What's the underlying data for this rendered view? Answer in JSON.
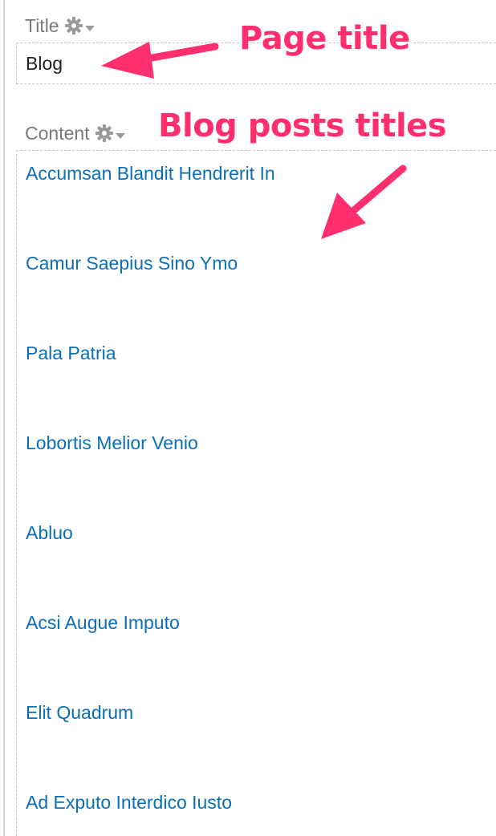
{
  "title_field": {
    "label": "Title",
    "gear_icon": "gear-icon",
    "caret_icon": "chevron-down-icon",
    "value": "Blog"
  },
  "content_field": {
    "label": "Content",
    "gear_icon": "gear-icon",
    "caret_icon": "chevron-down-icon",
    "posts": [
      "Accumsan Blandit Hendrerit In",
      "Camur Saepius Sino Ymo",
      "Pala Patria",
      "Lobortis Melior Venio",
      "Abluo",
      "Acsi Augue Imputo",
      "Elit Quadrum",
      "Ad Exputo Interdico Iusto"
    ]
  },
  "annotations": {
    "page_title": "Page title",
    "blog_posts_titles": "Blog posts titles",
    "color": "#ff2f6e"
  },
  "colors": {
    "link": "#0a6fb7",
    "label": "#7a7a7a",
    "text": "#222222",
    "border": "#c8c8c8"
  }
}
